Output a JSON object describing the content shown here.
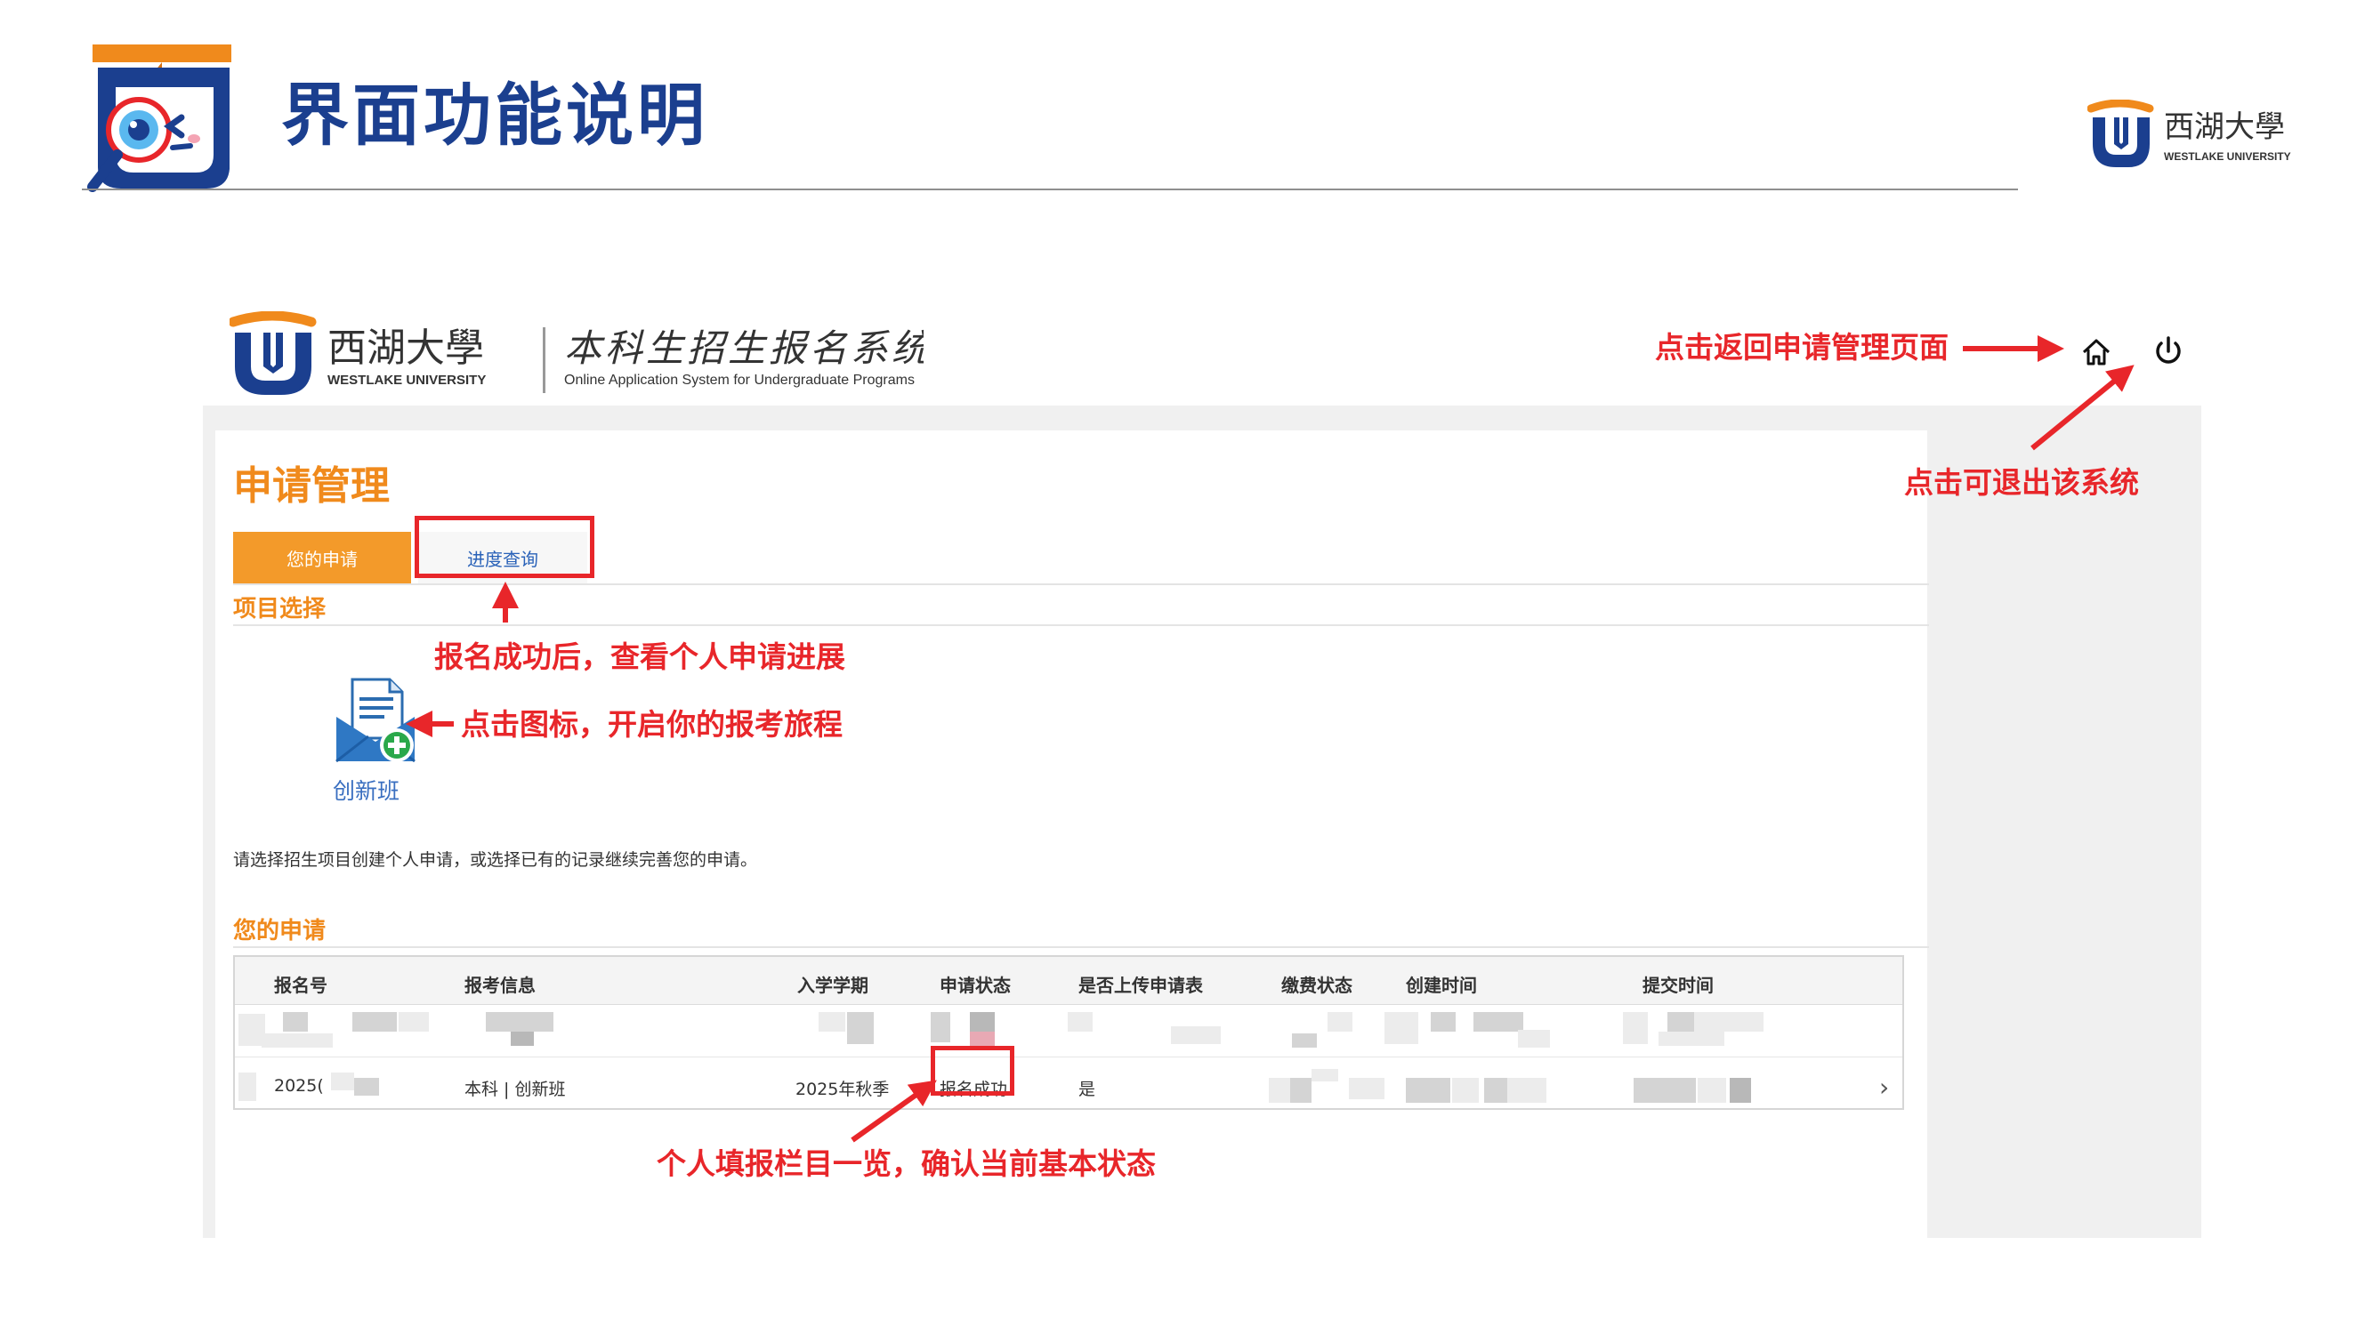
{
  "slide": {
    "title": "界面功能说明",
    "corner_logo": {
      "cn": "西湖大學",
      "en": "WESTLAKE UNIVERSITY"
    }
  },
  "system": {
    "logo_cn": "西湖大學",
    "logo_en": "WESTLAKE UNIVERSITY",
    "name_cn": "本科生招生报名系统",
    "name_en": "Online Application System for Undergraduate Programs",
    "home_icon": "home-icon",
    "power_icon": "power-icon"
  },
  "page": {
    "title": "申请管理",
    "tabs": [
      {
        "label": "您的申请",
        "active": true
      },
      {
        "label": "进度查询",
        "active": false
      }
    ],
    "project_section": "项目选择",
    "create_label": "创新班",
    "hint": "请选择招生项目创建个人申请，或选择已有的记录继续完善您的申请。",
    "applications_section": "您的申请",
    "table": {
      "headers": [
        "报名号",
        "报考信息",
        "入学学期",
        "申请状态",
        "是否上传申请表",
        "缴费状态",
        "创建时间",
        "提交时间"
      ],
      "row": {
        "id": "2025(",
        "info": "本科 | 创新班",
        "term": "2025年秋季",
        "status": "报名成功",
        "uploaded": "是"
      }
    }
  },
  "annotations": {
    "home": "点击返回申请管理页面",
    "logout": "点击可退出该系统",
    "progress": "报名成功后，查看个人申请进展",
    "create": "点击图标，开启你的报考旅程",
    "list": "个人填报栏目一览，确认当前基本状态"
  },
  "colors": {
    "brand_blue": "#1b3f8f",
    "brand_orange": "#f08a1c",
    "annotation_red": "#e8262a"
  }
}
